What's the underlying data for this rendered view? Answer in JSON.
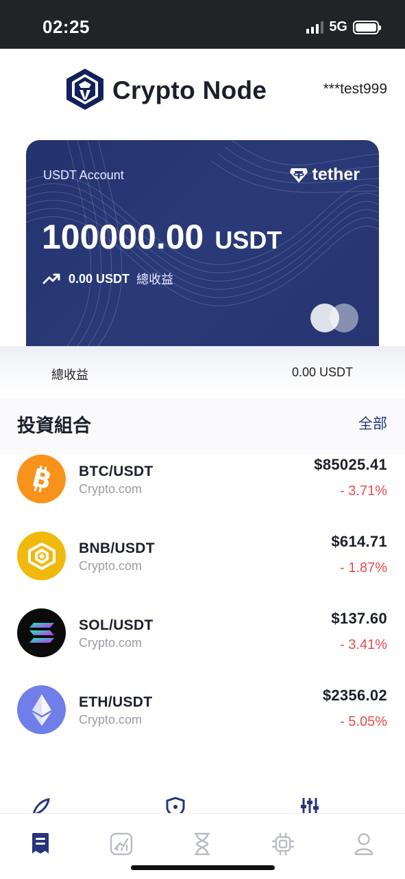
{
  "status_bar": {
    "time": "02:25",
    "network": "5G"
  },
  "header": {
    "brand": "Crypto Node",
    "user": "***test999",
    "logo_icon": "crypto-lion-shield-icon"
  },
  "card": {
    "label": "USDT Account",
    "brand_logo": "tether",
    "balance_amount": "100000.00",
    "balance_unit": "USDT",
    "profit_value": "0.00 USDT",
    "profit_label": "總收益",
    "colors": {
      "background": "#24336f"
    }
  },
  "summary": {
    "label": "總收益",
    "value": "0.00 USDT"
  },
  "portfolio": {
    "title": "投資組合",
    "all_link": "全部",
    "coins": [
      {
        "pair": "BTC/USDT",
        "source": "Crypto.com",
        "price": "$85025.41",
        "change": "- 3.71%",
        "icon": "bitcoin-icon",
        "color": "#f7931a"
      },
      {
        "pair": "BNB/USDT",
        "source": "Crypto.com",
        "price": "$614.71",
        "change": "- 1.87%",
        "icon": "bnb-icon",
        "color": "#f0b90b"
      },
      {
        "pair": "SOL/USDT",
        "source": "Crypto.com",
        "price": "$137.60",
        "change": "- 3.41%",
        "icon": "solana-icon",
        "color": "#0b0b0b"
      },
      {
        "pair": "ETH/USDT",
        "source": "Crypto.com",
        "price": "$2356.02",
        "change": "- 5.05%",
        "icon": "ethereum-icon",
        "color": "#6f7ee8"
      }
    ]
  },
  "tabbar": {
    "tabs": [
      {
        "icon": "receipt-icon",
        "active": true
      },
      {
        "icon": "chart-icon",
        "active": false
      },
      {
        "icon": "hourglass-icon",
        "active": false
      },
      {
        "icon": "chip-icon",
        "active": false
      },
      {
        "icon": "user-icon",
        "active": false
      }
    ],
    "colors": {
      "active": "#27357a",
      "inactive": "#b9bcc4"
    }
  }
}
